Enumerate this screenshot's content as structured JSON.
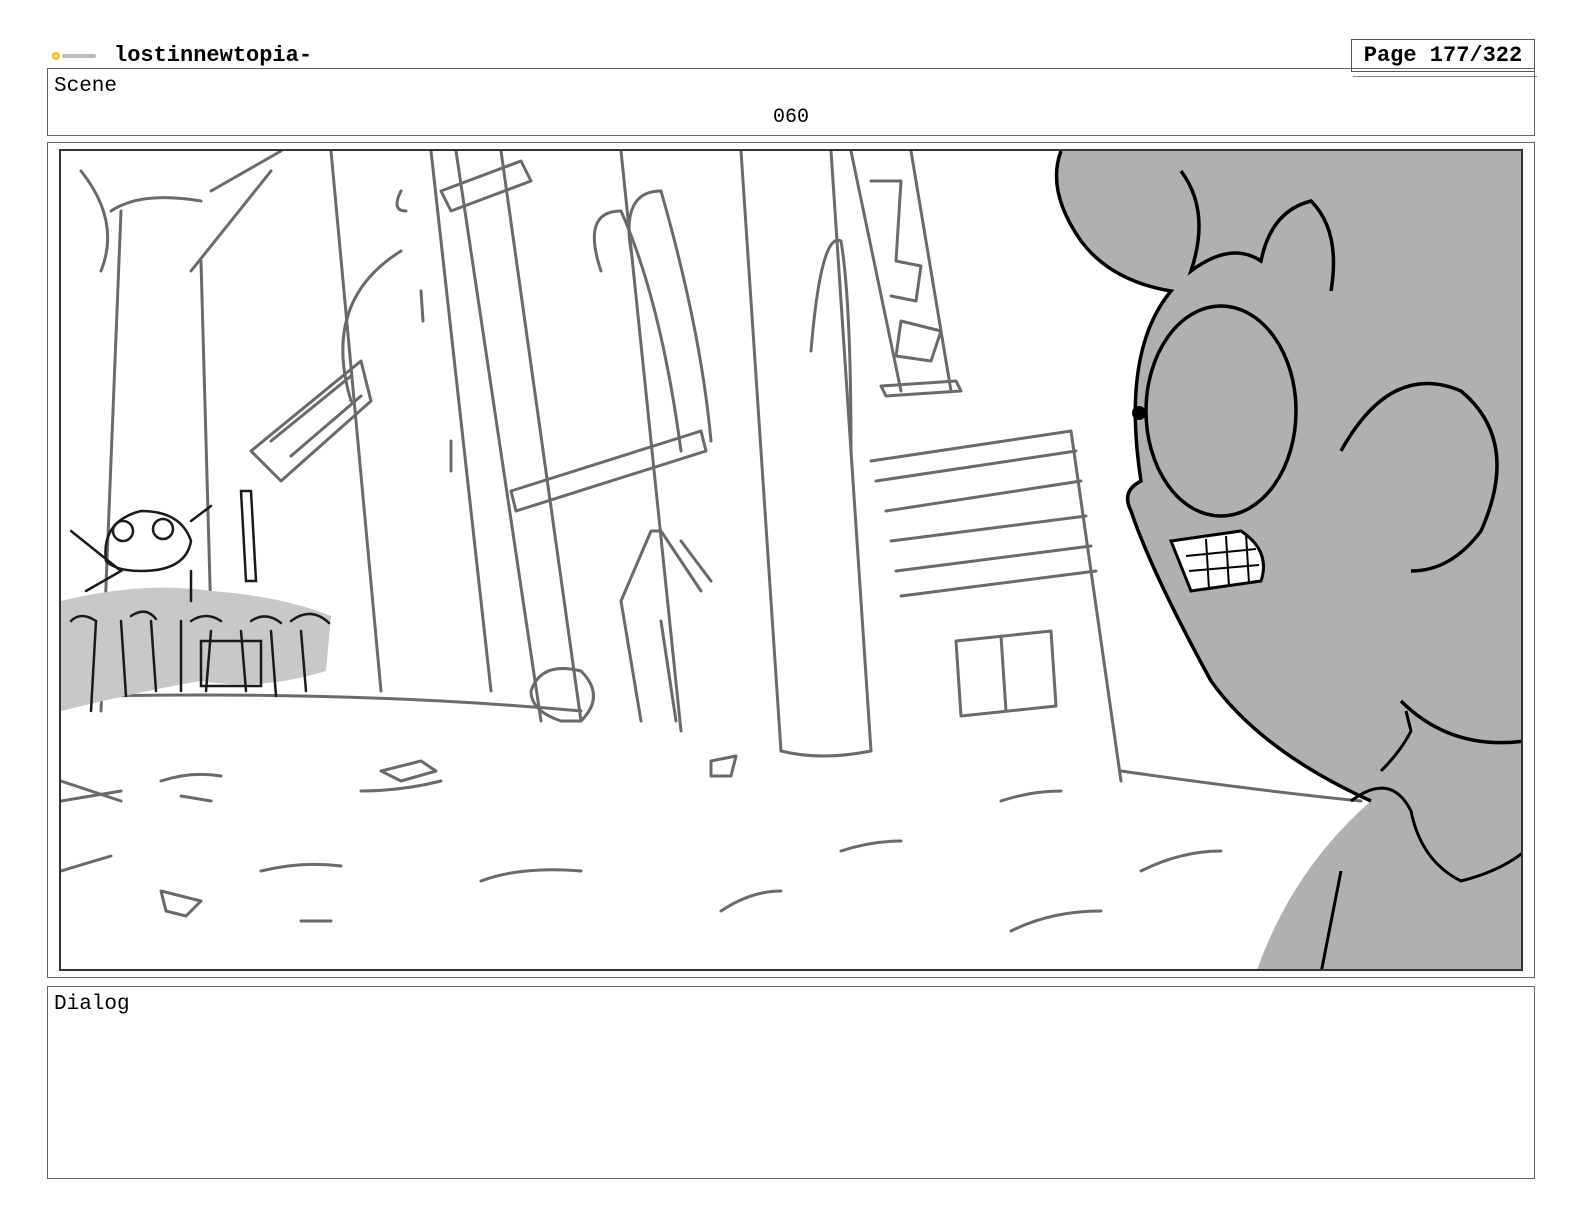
{
  "header": {
    "logo_icon": "toon-boom-logo",
    "title": "lostinnewtopia-",
    "page": "Page 177/322"
  },
  "scene": {
    "label": "Scene",
    "number": "060"
  },
  "panel": {
    "image": "storyboard-sketch-alley-crowd-shocked-character"
  },
  "dialog": {
    "label": "Dialog",
    "text": ""
  }
}
